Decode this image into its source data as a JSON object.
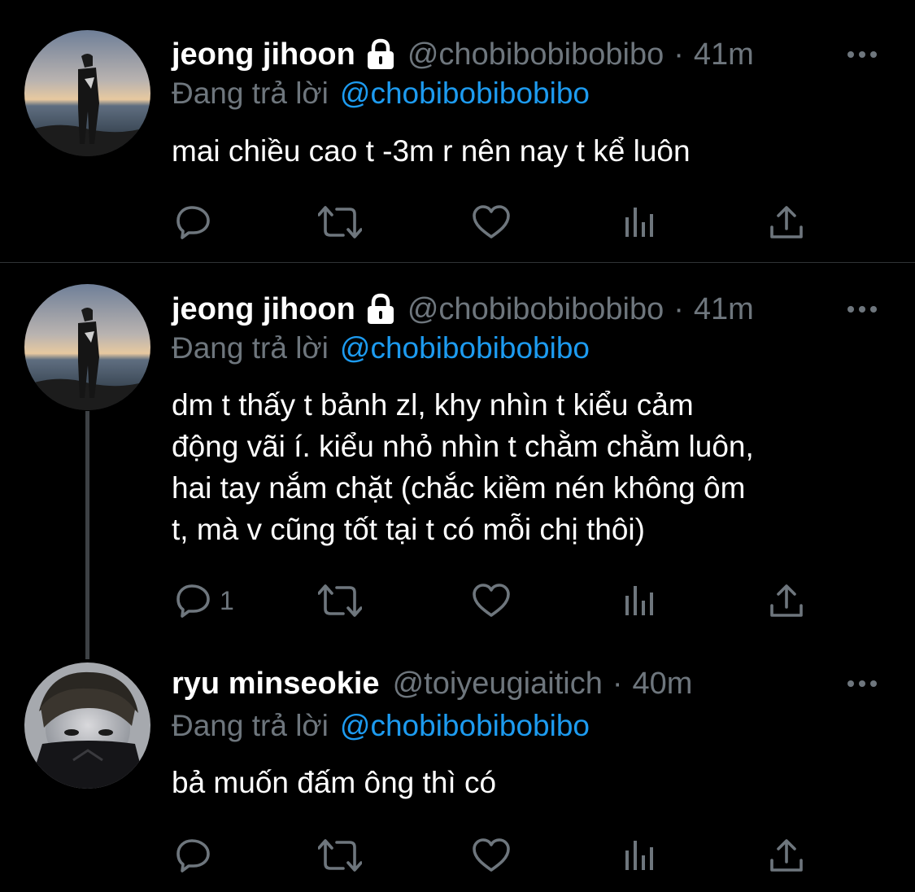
{
  "tweets": [
    {
      "name": "jeong jihoon",
      "handle": "@chobibobibobibo",
      "dot": "·",
      "time": "41m",
      "reply_prefix": "Đang trả lời",
      "reply_to": "@chobibobibobibo",
      "text": "mai chiều cao t -3m r nên nay t kể luôn",
      "reply_count": ""
    },
    {
      "name": "jeong jihoon",
      "handle": "@chobibobibobibo",
      "dot": "·",
      "time": "41m",
      "reply_prefix": "Đang trả lời",
      "reply_to": "@chobibobibobibo",
      "text": "dm t thấy t bảnh zl, khy nhìn t kiểu cảm\nđộng vãi í. kiểu nhỏ nhìn t chằm chằm luôn,\nhai tay nắm chặt (chắc kiềm nén không ôm\nt, mà v cũng tốt tại t có mỗi chị thôi)",
      "reply_count": "1"
    },
    {
      "name": "ryu minseokie",
      "handle": "@toiyeugiaitich",
      "dot": "·",
      "time": "40m",
      "reply_prefix": "Đang trả lời",
      "reply_to": "@chobibobibobibo",
      "text": "bả muốn đấm ông thì có",
      "reply_count": ""
    }
  ],
  "icons": {
    "protected": "lock-icon",
    "more": "more-icon",
    "reply": "reply-icon",
    "retweet": "retweet-icon",
    "like": "like-icon",
    "analytics": "analytics-icon",
    "share": "share-icon"
  },
  "colors": {
    "background": "#000000",
    "text": "#ffffff",
    "muted": "#6e767d",
    "link": "#1d9bf0",
    "divider": "#2f3336"
  }
}
